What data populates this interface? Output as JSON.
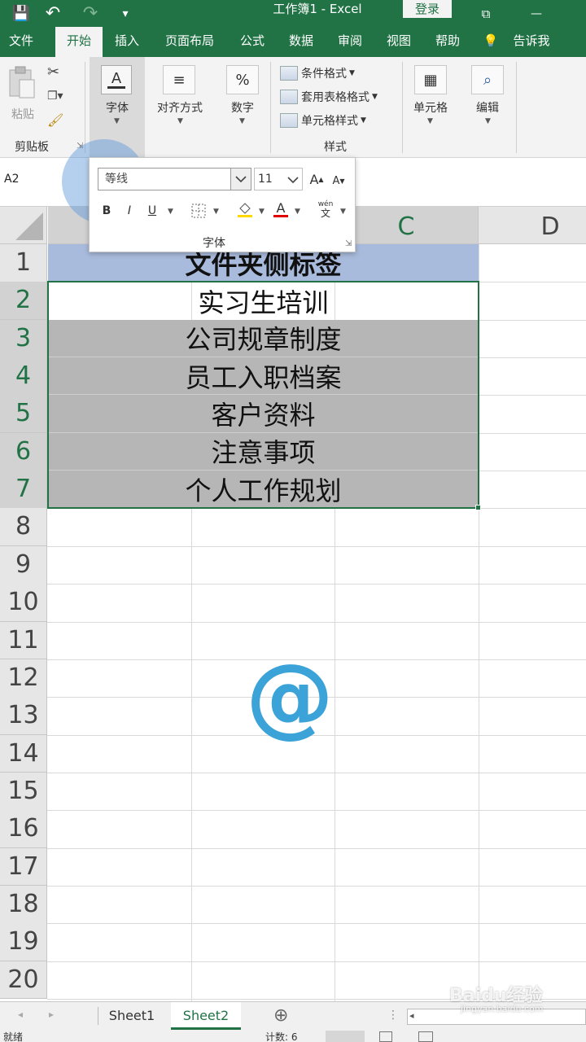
{
  "titlebar": {
    "title": "工作簿1 - Excel",
    "login": "登录",
    "save_icon": "💾",
    "undo_icon": "↶",
    "redo_icon": "↷",
    "customize_icon": "▾",
    "restore_icon": "⧉",
    "minimize_icon": "—"
  },
  "tabs": [
    "文件",
    "开始",
    "插入",
    "页面布局",
    "公式",
    "数据",
    "审阅",
    "视图",
    "帮助",
    "告诉我"
  ],
  "ribbon": {
    "paste_label": "粘贴",
    "clipboard_label": "剪贴板",
    "font_label": "字体",
    "align_label": "对齐方式",
    "number_label": "数字",
    "conditional_format": "条件格式",
    "table_format": "套用表格格式",
    "cell_style": "单元格样式",
    "styles_label": "样式",
    "cells_label": "单元格",
    "edit_label": "编辑",
    "tell_icon": "💡"
  },
  "namebox": "A2",
  "font_popup": {
    "font_name": "等线",
    "font_size": "11",
    "grow": "A",
    "shrink": "A",
    "bold": "B",
    "italic": "I",
    "underline": "U",
    "font_color": "A",
    "phonetic": "wén",
    "phonetic_sub": "文",
    "label": "字体"
  },
  "columns": [
    "C",
    "D"
  ],
  "rows": [
    "1",
    "2",
    "3",
    "4",
    "5",
    "6",
    "7",
    "8",
    "9",
    "10",
    "11",
    "12",
    "13",
    "14",
    "15",
    "16",
    "17",
    "18",
    "19",
    "20"
  ],
  "cells": [
    {
      "row": "1",
      "text": "文件夹侧标签",
      "style": "hdr"
    },
    {
      "row": "2",
      "text": "实习生培训",
      "style": "white"
    },
    {
      "row": "3",
      "text": "公司规章制度",
      "style": "gray"
    },
    {
      "row": "4",
      "text": "员工入职档案",
      "style": "gray"
    },
    {
      "row": "5",
      "text": "客户资料",
      "style": "gray"
    },
    {
      "row": "6",
      "text": "注意事项",
      "style": "gray"
    },
    {
      "row": "7",
      "text": "个人工作规划",
      "style": "gray"
    }
  ],
  "watermark": "@",
  "sheets": [
    "Sheet1",
    "Sheet2"
  ],
  "active_sheet": "Sheet2",
  "add_sheet_icon": "⊕",
  "status": {
    "ready": "就绪",
    "count": "计数: 6"
  },
  "baidu_logo": "Baidu经验",
  "baidu_url": "jingyan.baidu.com"
}
